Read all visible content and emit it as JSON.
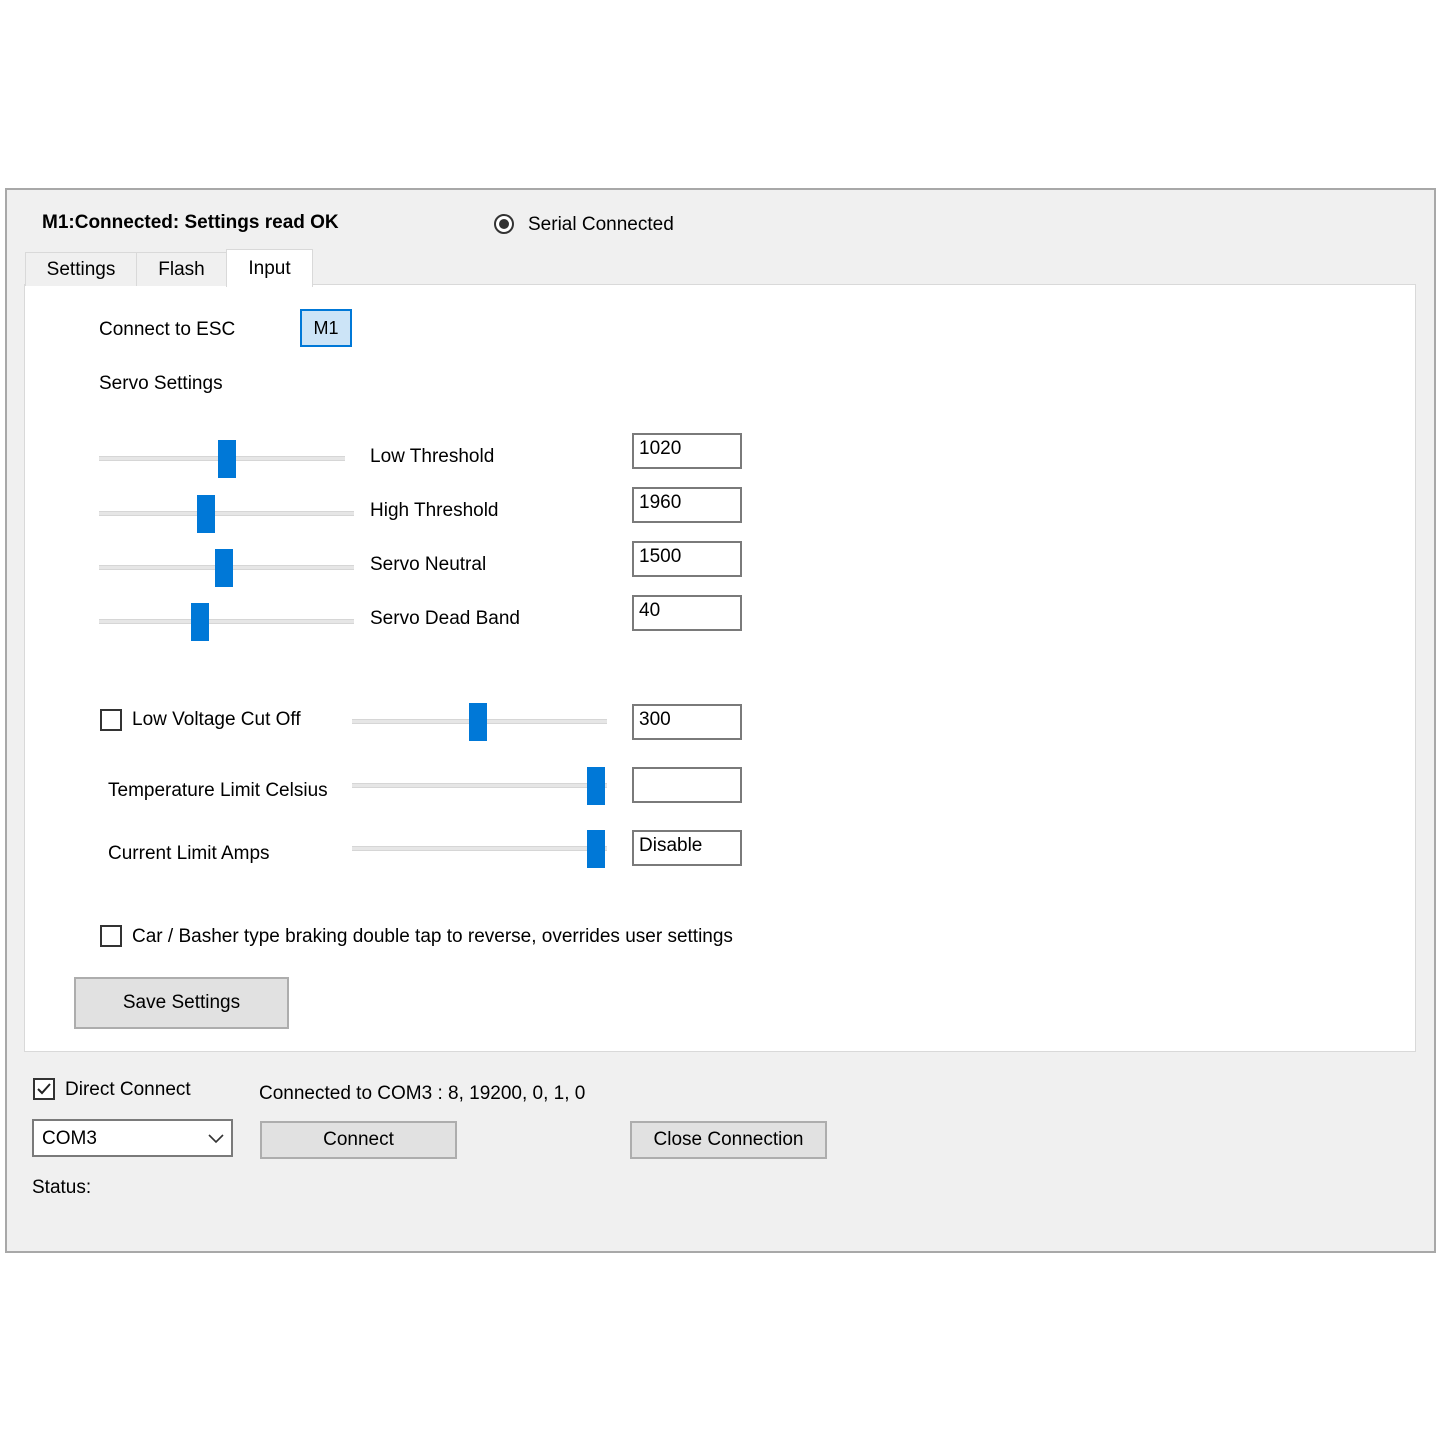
{
  "header": {
    "status_title": "M1:Connected: Settings read OK",
    "serial_radio_label": "Serial Connected"
  },
  "tabs": [
    {
      "label": "Settings",
      "active": false
    },
    {
      "label": "Flash",
      "active": false
    },
    {
      "label": "Input",
      "active": true
    }
  ],
  "input_tab": {
    "connect_label": "Connect to ESC",
    "esc_button": "M1",
    "servo_settings_label": "Servo Settings",
    "sliders": [
      {
        "label": "Low Threshold",
        "value": "1020",
        "level": 0.52
      },
      {
        "label": "High Threshold",
        "value": "1960",
        "level": 0.41
      },
      {
        "label": "Servo Neutral",
        "value": "1500",
        "level": 0.49
      },
      {
        "label": "Servo Dead Band",
        "value": "40",
        "level": 0.39
      }
    ],
    "low_voltage": {
      "label": "Low Voltage Cut Off",
      "checked": false,
      "value": "300",
      "level": 0.5
    },
    "temperature": {
      "label": "Temperature Limit Celsius",
      "value": "",
      "level": 1.0
    },
    "current": {
      "label": "Current Limit Amps",
      "value": "Disable",
      "level": 1.0
    },
    "braking": {
      "label": "Car / Basher type braking double tap to reverse, overrides user settings",
      "checked": false
    },
    "save_button": "Save Settings"
  },
  "footer": {
    "direct_connect_label": "Direct Connect",
    "direct_connect_checked": true,
    "connection_info": "Connected to COM3 : 8, 19200, 0, 1, 0",
    "port_selected": "COM3",
    "connect_button": "Connect",
    "close_button": "Close Connection",
    "status_label": "Status:"
  },
  "colors": {
    "accent": "#0078d7",
    "window_bg": "#f0f0f0",
    "panel_bg": "#ffffff"
  }
}
